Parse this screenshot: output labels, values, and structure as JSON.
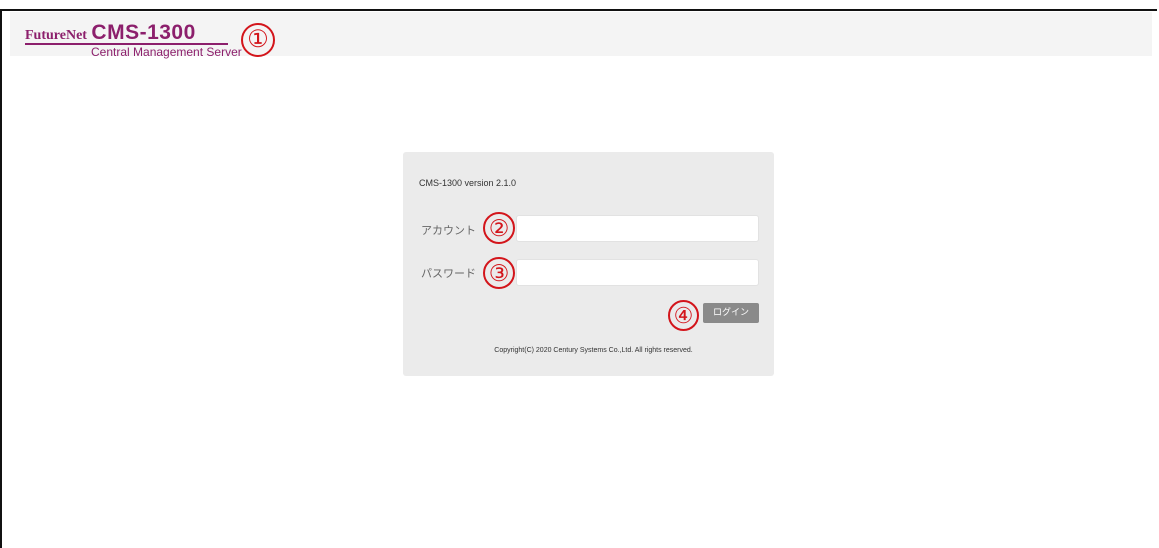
{
  "header": {
    "logo_brand": "FutureNet",
    "logo_product": "CMS-1300",
    "logo_subtitle": "Central Management Server"
  },
  "annotations": {
    "marker_1": "①",
    "marker_2": "②",
    "marker_3": "③",
    "marker_4": "④",
    "color": "#d3151b"
  },
  "login": {
    "version": "CMS-1300 version 2.1.0",
    "account_label": "アカウント",
    "account_value": "",
    "account_placeholder": "",
    "password_label": "パスワード",
    "password_value": "",
    "password_placeholder": "",
    "login_button": "ログイン",
    "copyright": "Copyright(C) 2020 Century Systems Co.,Ltd. All rights reserved."
  },
  "colors": {
    "brand": "#8c1f6c",
    "panel_bg": "#ebebeb",
    "button_bg": "#8a8a8a"
  }
}
